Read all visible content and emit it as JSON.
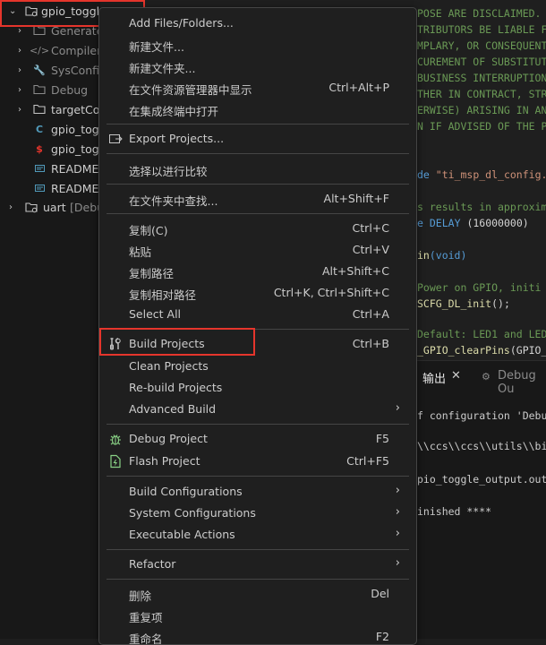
{
  "tree": {
    "items": [
      {
        "label": "gpio_toggl",
        "suffix": "",
        "icon": "folder-project-icon"
      },
      {
        "label": "Generate",
        "suffix": "",
        "icon": "folder-icon"
      },
      {
        "label": "Compiler",
        "suffix": "",
        "icon": "code-icon"
      },
      {
        "label": "SysConfig",
        "suffix": "",
        "icon": "wrench-icon"
      },
      {
        "label": "Debug",
        "suffix": "",
        "icon": "folder-icon"
      },
      {
        "label": "targetCon",
        "suffix": "",
        "icon": "folder-icon"
      },
      {
        "label": "gpio_tog",
        "suffix": "",
        "icon": "c-file-icon"
      },
      {
        "label": "gpio_tog",
        "suffix": "",
        "icon": "syscfg-file-icon"
      },
      {
        "label": "README.",
        "suffix": "",
        "icon": "readme-icon"
      },
      {
        "label": "README.",
        "suffix": "",
        "icon": "readme-icon"
      },
      {
        "label": "uart",
        "suffix": "[Debu",
        "icon": "folder-project-icon"
      }
    ]
  },
  "editor": {
    "lines": [
      "POSE ARE DISCLAIMED.",
      "TRIBUTORS BE LIABLE F",
      "MPLARY, OR CONSEQUENT",
      "CUREMENT OF SUBSTITUT",
      "BUSINESS INTERRUPTION",
      "THER IN CONTRACT, STR",
      "ERWISE) ARISING IN AN",
      "N IF ADVISED OF THE P"
    ],
    "include_kw": "de",
    "include_str": "\"ti_msp_dl_config.",
    "comment1": "s results in approxim",
    "define_kw": "e",
    "define_name": "DELAY",
    "define_val": "(16000000)",
    "main_fn": "in",
    "main_args": "(void)",
    "comment2": "Power on GPIO, initi",
    "call1_fn": "SCFG_DL_init",
    "call1_rest": "();",
    "comment3": "Default: LED1 and LED",
    "call2_fn": "_GPIO_clearPins",
    "call2_rest": "(GPIO_"
  },
  "panel": {
    "tab_output": "输出",
    "tab_close": "✕",
    "tab_debug": "Debug Ou",
    "lines": [
      "f configuration 'Debu",
      "\\\\ccs\\\\ccs\\\\utils\\\\bi",
      "pio_toggle_output.out",
      "inished ****"
    ]
  },
  "menu": {
    "groups": [
      [
        {
          "label": "Add Files/Folders...",
          "shortcut": ""
        },
        {
          "label": "新建文件...",
          "shortcut": ""
        },
        {
          "label": "新建文件夹...",
          "shortcut": ""
        },
        {
          "label": "在文件资源管理器中显示",
          "shortcut": "Ctrl+Alt+P"
        },
        {
          "label": "在集成终端中打开",
          "shortcut": ""
        }
      ],
      [
        {
          "label": "Export Projects...",
          "shortcut": "",
          "icon": "export-icon"
        }
      ],
      [
        {
          "label": "选择以进行比较",
          "shortcut": ""
        }
      ],
      [
        {
          "label": "在文件夹中查找...",
          "shortcut": "Alt+Shift+F"
        }
      ],
      [
        {
          "label": "复制(C)",
          "shortcut": "Ctrl+C"
        },
        {
          "label": "粘贴",
          "shortcut": "Ctrl+V"
        },
        {
          "label": "复制路径",
          "shortcut": "Alt+Shift+C"
        },
        {
          "label": "复制相对路径",
          "shortcut": "Ctrl+K, Ctrl+Shift+C"
        },
        {
          "label": "Select All",
          "shortcut": "Ctrl+A"
        }
      ],
      [
        {
          "label": "Build Projects",
          "shortcut": "Ctrl+B",
          "icon": "build-tools-icon"
        },
        {
          "label": "Clean Projects",
          "shortcut": ""
        },
        {
          "label": "Re-build Projects",
          "shortcut": ""
        },
        {
          "label": "Advanced Build",
          "shortcut": "",
          "submenu": true
        }
      ],
      [
        {
          "label": "Debug Project",
          "shortcut": "F5",
          "icon": "debug-bug-icon"
        },
        {
          "label": "Flash Project",
          "shortcut": "Ctrl+F5",
          "icon": "flash-icon"
        }
      ],
      [
        {
          "label": "Build Configurations",
          "shortcut": "",
          "submenu": true
        },
        {
          "label": "System Configurations",
          "shortcut": "",
          "submenu": true
        },
        {
          "label": "Executable Actions",
          "shortcut": "",
          "submenu": true
        }
      ],
      [
        {
          "label": "Refactor",
          "shortcut": "",
          "submenu": true
        }
      ],
      [
        {
          "label": "删除",
          "shortcut": "Del"
        },
        {
          "label": "重复项",
          "shortcut": ""
        },
        {
          "label": "重命名",
          "shortcut": "F2"
        }
      ]
    ]
  },
  "colors": {
    "highlight_outline": "#e5352c",
    "menu_bg": "#1f1f1f",
    "comment": "#6a9955"
  }
}
